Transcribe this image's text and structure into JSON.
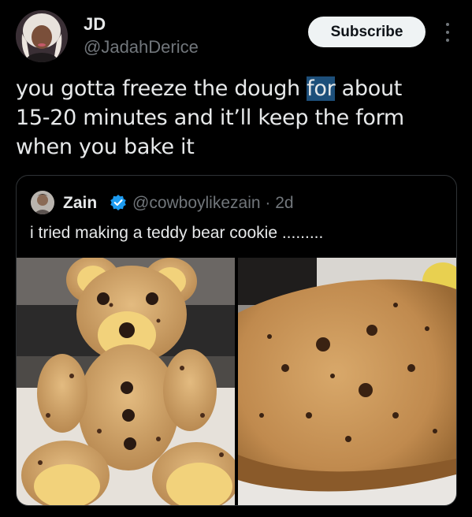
{
  "author": {
    "name": "JD",
    "handle": "@JadahDerice"
  },
  "subscribe_label": "Subscribe",
  "tweet": {
    "line1_before": "you gotta freeze the dough ",
    "line1_highlight": "for",
    "line1_after": " about",
    "line2": "15-20 minutes and it’ll keep the form",
    "line3": "when you bake it"
  },
  "quoted": {
    "name": "Zain",
    "handle_meta": "@cowboylikezain · 2d",
    "text": "i tried making a teddy bear cookie ........."
  },
  "icons": {
    "more": "more-options-icon",
    "verified": "verified-badge-icon"
  },
  "colors": {
    "accent": "#1d9bf0",
    "highlight": "#1d4f7a"
  }
}
